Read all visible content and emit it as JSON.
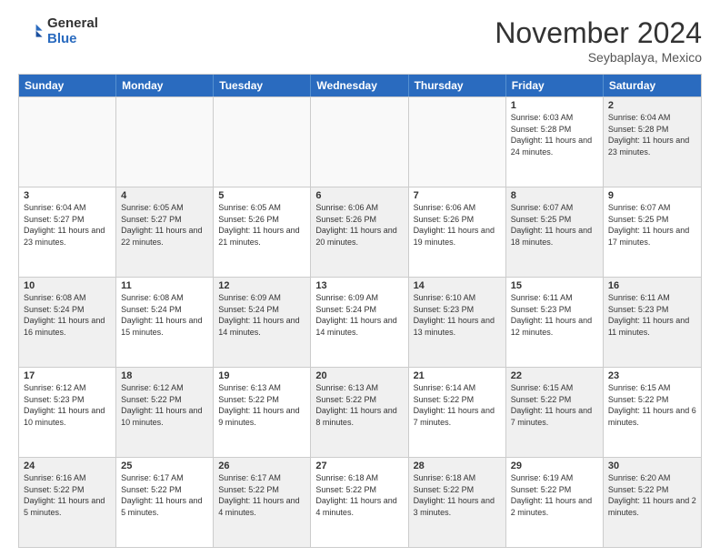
{
  "logo": {
    "general": "General",
    "blue": "Blue"
  },
  "header": {
    "month": "November 2024",
    "location": "Seybaplaya, Mexico"
  },
  "weekdays": [
    "Sunday",
    "Monday",
    "Tuesday",
    "Wednesday",
    "Thursday",
    "Friday",
    "Saturday"
  ],
  "rows": [
    [
      {
        "day": "",
        "info": "",
        "empty": true
      },
      {
        "day": "",
        "info": "",
        "empty": true
      },
      {
        "day": "",
        "info": "",
        "empty": true
      },
      {
        "day": "",
        "info": "",
        "empty": true
      },
      {
        "day": "",
        "info": "",
        "empty": true
      },
      {
        "day": "1",
        "info": "Sunrise: 6:03 AM\nSunset: 5:28 PM\nDaylight: 11 hours and 24 minutes."
      },
      {
        "day": "2",
        "info": "Sunrise: 6:04 AM\nSunset: 5:28 PM\nDaylight: 11 hours and 23 minutes.",
        "alt": true
      }
    ],
    [
      {
        "day": "3",
        "info": "Sunrise: 6:04 AM\nSunset: 5:27 PM\nDaylight: 11 hours and 23 minutes."
      },
      {
        "day": "4",
        "info": "Sunrise: 6:05 AM\nSunset: 5:27 PM\nDaylight: 11 hours and 22 minutes.",
        "alt": true
      },
      {
        "day": "5",
        "info": "Sunrise: 6:05 AM\nSunset: 5:26 PM\nDaylight: 11 hours and 21 minutes."
      },
      {
        "day": "6",
        "info": "Sunrise: 6:06 AM\nSunset: 5:26 PM\nDaylight: 11 hours and 20 minutes.",
        "alt": true
      },
      {
        "day": "7",
        "info": "Sunrise: 6:06 AM\nSunset: 5:26 PM\nDaylight: 11 hours and 19 minutes."
      },
      {
        "day": "8",
        "info": "Sunrise: 6:07 AM\nSunset: 5:25 PM\nDaylight: 11 hours and 18 minutes.",
        "alt": true
      },
      {
        "day": "9",
        "info": "Sunrise: 6:07 AM\nSunset: 5:25 PM\nDaylight: 11 hours and 17 minutes."
      }
    ],
    [
      {
        "day": "10",
        "info": "Sunrise: 6:08 AM\nSunset: 5:24 PM\nDaylight: 11 hours and 16 minutes.",
        "alt": true
      },
      {
        "day": "11",
        "info": "Sunrise: 6:08 AM\nSunset: 5:24 PM\nDaylight: 11 hours and 15 minutes."
      },
      {
        "day": "12",
        "info": "Sunrise: 6:09 AM\nSunset: 5:24 PM\nDaylight: 11 hours and 14 minutes.",
        "alt": true
      },
      {
        "day": "13",
        "info": "Sunrise: 6:09 AM\nSunset: 5:24 PM\nDaylight: 11 hours and 14 minutes."
      },
      {
        "day": "14",
        "info": "Sunrise: 6:10 AM\nSunset: 5:23 PM\nDaylight: 11 hours and 13 minutes.",
        "alt": true
      },
      {
        "day": "15",
        "info": "Sunrise: 6:11 AM\nSunset: 5:23 PM\nDaylight: 11 hours and 12 minutes."
      },
      {
        "day": "16",
        "info": "Sunrise: 6:11 AM\nSunset: 5:23 PM\nDaylight: 11 hours and 11 minutes.",
        "alt": true
      }
    ],
    [
      {
        "day": "17",
        "info": "Sunrise: 6:12 AM\nSunset: 5:23 PM\nDaylight: 11 hours and 10 minutes."
      },
      {
        "day": "18",
        "info": "Sunrise: 6:12 AM\nSunset: 5:22 PM\nDaylight: 11 hours and 10 minutes.",
        "alt": true
      },
      {
        "day": "19",
        "info": "Sunrise: 6:13 AM\nSunset: 5:22 PM\nDaylight: 11 hours and 9 minutes."
      },
      {
        "day": "20",
        "info": "Sunrise: 6:13 AM\nSunset: 5:22 PM\nDaylight: 11 hours and 8 minutes.",
        "alt": true
      },
      {
        "day": "21",
        "info": "Sunrise: 6:14 AM\nSunset: 5:22 PM\nDaylight: 11 hours and 7 minutes."
      },
      {
        "day": "22",
        "info": "Sunrise: 6:15 AM\nSunset: 5:22 PM\nDaylight: 11 hours and 7 minutes.",
        "alt": true
      },
      {
        "day": "23",
        "info": "Sunrise: 6:15 AM\nSunset: 5:22 PM\nDaylight: 11 hours and 6 minutes."
      }
    ],
    [
      {
        "day": "24",
        "info": "Sunrise: 6:16 AM\nSunset: 5:22 PM\nDaylight: 11 hours and 5 minutes.",
        "alt": true
      },
      {
        "day": "25",
        "info": "Sunrise: 6:17 AM\nSunset: 5:22 PM\nDaylight: 11 hours and 5 minutes."
      },
      {
        "day": "26",
        "info": "Sunrise: 6:17 AM\nSunset: 5:22 PM\nDaylight: 11 hours and 4 minutes.",
        "alt": true
      },
      {
        "day": "27",
        "info": "Sunrise: 6:18 AM\nSunset: 5:22 PM\nDaylight: 11 hours and 4 minutes."
      },
      {
        "day": "28",
        "info": "Sunrise: 6:18 AM\nSunset: 5:22 PM\nDaylight: 11 hours and 3 minutes.",
        "alt": true
      },
      {
        "day": "29",
        "info": "Sunrise: 6:19 AM\nSunset: 5:22 PM\nDaylight: 11 hours and 2 minutes."
      },
      {
        "day": "30",
        "info": "Sunrise: 6:20 AM\nSunset: 5:22 PM\nDaylight: 11 hours and 2 minutes.",
        "alt": true
      }
    ]
  ]
}
